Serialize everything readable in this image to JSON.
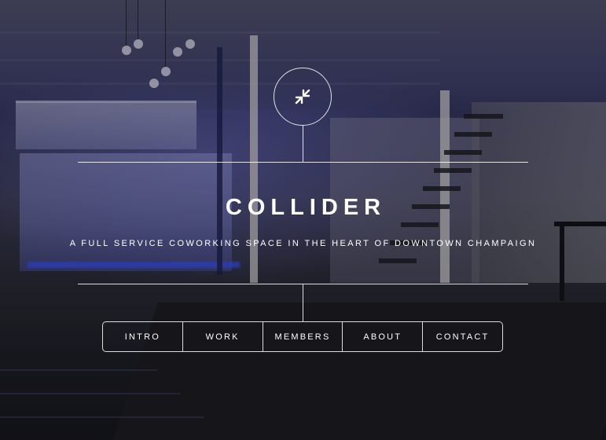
{
  "hero": {
    "logo_icon": "collapse-arrows-icon",
    "title": "COLLIDER",
    "subtitle": "A FULL SERVICE COWORKING SPACE IN THE HEART OF DOWNTOWN CHAMPAIGN"
  },
  "nav": {
    "items": [
      {
        "label": "INTRO"
      },
      {
        "label": "WORK"
      },
      {
        "label": "MEMBERS"
      },
      {
        "label": "ABOUT"
      },
      {
        "label": "CONTACT"
      }
    ]
  },
  "colors": {
    "text": "#ffffff",
    "line": "#ffffff"
  }
}
